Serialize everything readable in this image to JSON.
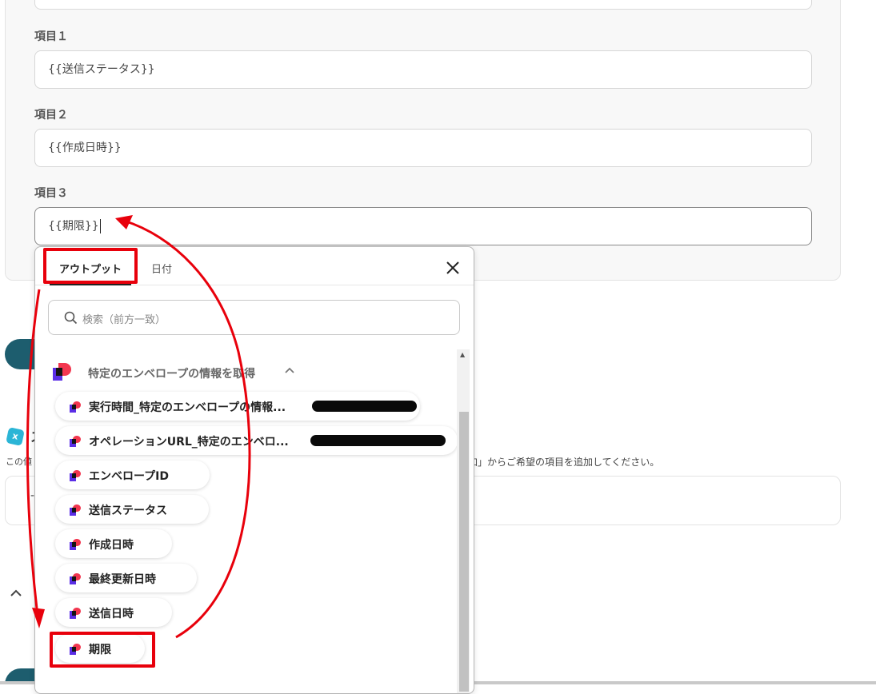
{
  "form": {
    "fields": [
      {
        "label": "項目１",
        "value": "{{送信ステータス}}"
      },
      {
        "label": "項目２",
        "value": "{{作成日時}}"
      },
      {
        "label": "項目３",
        "value": "{{期限}}"
      }
    ]
  },
  "background": {
    "badge": "x",
    "heading_fragment": "ス",
    "note_left": "この値",
    "note_right": "追加」からご希望の項目を追加してください。",
    "dash": "-"
  },
  "popup": {
    "tabs": [
      {
        "label": "アウトプット",
        "active": true
      },
      {
        "label": "日付",
        "active": false
      }
    ],
    "search_placeholder": "検索（前方一致）",
    "group_title": "特定のエンベロープの情報を取得",
    "items": [
      {
        "label": "実行時間_特定のエンベロープの情報...",
        "redacted": true
      },
      {
        "label": "オペレーションURL_特定のエンベロ...",
        "redacted": true
      },
      {
        "label": "エンベロープID"
      },
      {
        "label": "送信ステータス"
      },
      {
        "label": "作成日時"
      },
      {
        "label": "最終更新日時"
      },
      {
        "label": "送信日時"
      },
      {
        "label": "期限"
      }
    ]
  },
  "colors": {
    "annotation": "#e8000b",
    "brand_red": "#f2364f",
    "brand_purple": "#5b2ee6",
    "brand_dark": "#141414",
    "accent_teal": "#1d5d6e"
  }
}
